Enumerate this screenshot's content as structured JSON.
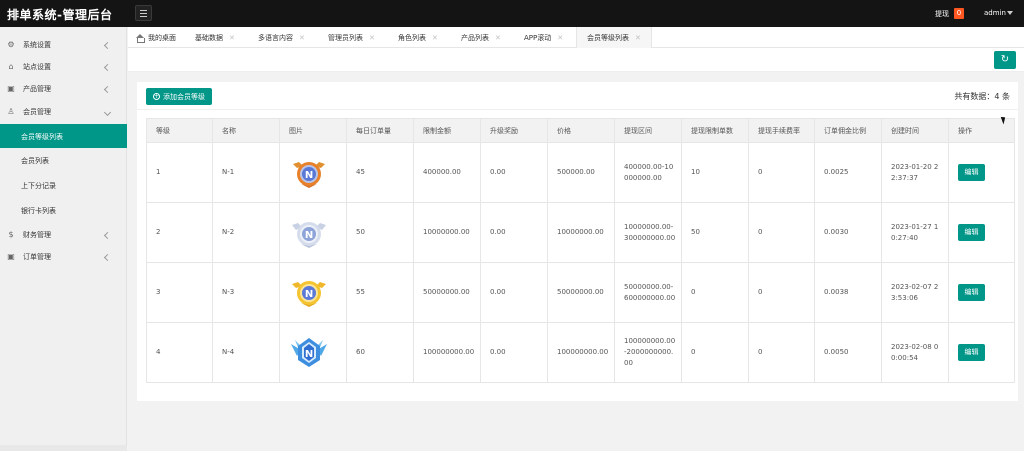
{
  "header": {
    "brand": "排单系统-管理后台",
    "withdraw_label": "提现",
    "withdraw_count": "0",
    "user": "admin"
  },
  "sidebar": {
    "items": [
      {
        "label": "系统设置",
        "icon": "gear-icon"
      },
      {
        "label": "站点设置",
        "icon": "site-icon"
      },
      {
        "label": "产品管理",
        "icon": "box-icon"
      },
      {
        "label": "会员管理",
        "icon": "user-icon"
      }
    ],
    "sub_items": [
      {
        "label": "会员等级列表",
        "active": true
      },
      {
        "label": "会员列表",
        "active": false
      },
      {
        "label": "上下分记录",
        "active": false
      },
      {
        "label": "银行卡列表",
        "active": false
      }
    ],
    "bottom_items": [
      {
        "label": "财务管理",
        "icon": "dollar-icon"
      },
      {
        "label": "订单管理",
        "icon": "box-icon"
      }
    ]
  },
  "tabs": [
    {
      "label": "我的桌面"
    },
    {
      "label": "基础数据"
    },
    {
      "label": "多语言内容"
    },
    {
      "label": "管理员列表"
    },
    {
      "label": "角色列表"
    },
    {
      "label": "产品列表"
    },
    {
      "label": "APP滚动"
    },
    {
      "label": "会员等级列表"
    }
  ],
  "toolbar": {
    "add_label": "添加会员等级",
    "total_label": "共有数据：4 条"
  },
  "table": {
    "columns": [
      "等级",
      "名称",
      "图片",
      "每日订单量",
      "限制金额",
      "升级奖励",
      "价格",
      "提现区间",
      "提现限制单数",
      "提现手续费率",
      "订单佣金比例",
      "创建时间",
      "操作"
    ],
    "rows": [
      {
        "level": "1",
        "name": "N-1",
        "badge": "bronze",
        "daily_orders": "45",
        "limit": "400000.00",
        "reward": "0.00",
        "price": "500000.00",
        "range": "400000.00-10000000.00",
        "withdraw_count": "10",
        "fee_rate": "0",
        "commission": "0.0025",
        "created": "2023-01-20 22:37:37",
        "action": "编辑"
      },
      {
        "level": "2",
        "name": "N-2",
        "badge": "silver",
        "daily_orders": "50",
        "limit": "10000000.00",
        "reward": "0.00",
        "price": "10000000.00",
        "range": "10000000.00-300000000.00",
        "withdraw_count": "50",
        "fee_rate": "0",
        "commission": "0.0030",
        "created": "2023-01-27 10:27:40",
        "action": "编辑"
      },
      {
        "level": "3",
        "name": "N-3",
        "badge": "gold",
        "daily_orders": "55",
        "limit": "50000000.00",
        "reward": "0.00",
        "price": "50000000.00",
        "range": "50000000.00-600000000.00",
        "withdraw_count": "0",
        "fee_rate": "0",
        "commission": "0.0038",
        "created": "2023-02-07 23:53:06",
        "action": "编辑"
      },
      {
        "level": "4",
        "name": "N-4",
        "badge": "diamond",
        "daily_orders": "60",
        "limit": "100000000.00",
        "reward": "0.00",
        "price": "100000000.00",
        "range": "100000000.00-2000000000.00",
        "withdraw_count": "0",
        "fee_rate": "0",
        "commission": "0.0050",
        "created": "2023-02-08 00:00:54",
        "action": "编辑"
      }
    ]
  },
  "colors": {
    "accent": "#009688",
    "topbar": "#141414",
    "badge": "#ff5722"
  }
}
